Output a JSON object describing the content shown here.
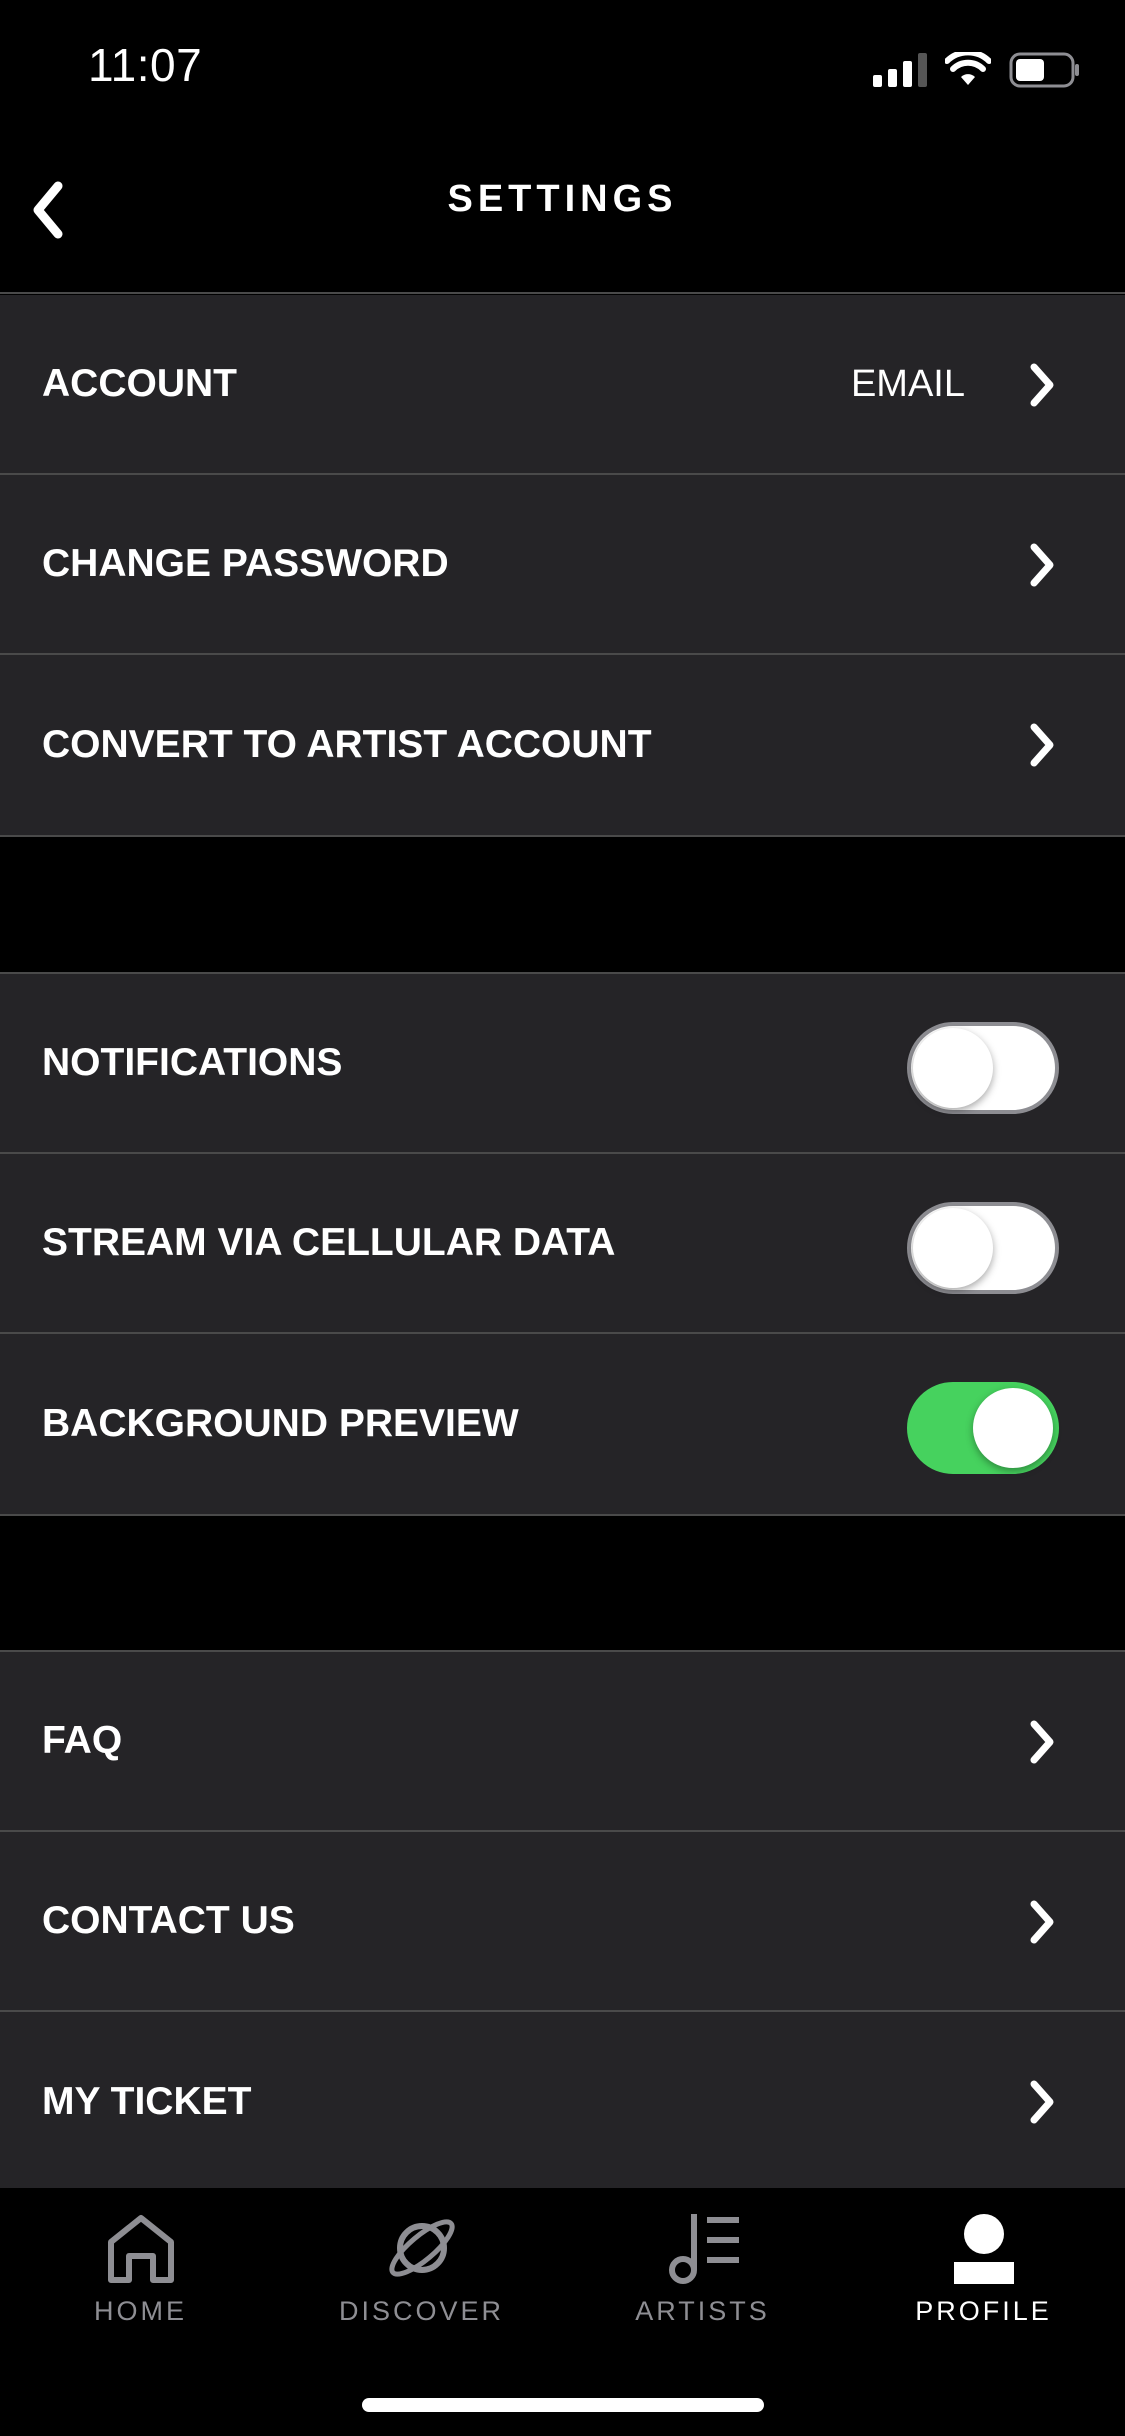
{
  "status_bar": {
    "time": "11:07"
  },
  "header": {
    "title": "SETTINGS"
  },
  "account_group": [
    {
      "label": "ACCOUNT",
      "value": "EMAIL"
    },
    {
      "label": "CHANGE PASSWORD"
    },
    {
      "label": "CONVERT TO ARTIST ACCOUNT"
    }
  ],
  "toggle_group": [
    {
      "label": "NOTIFICATIONS",
      "on": false
    },
    {
      "label": "STREAM VIA CELLULAR DATA",
      "on": false
    },
    {
      "label": "BACKGROUND PREVIEW",
      "on": true
    }
  ],
  "support_group": [
    {
      "label": "FAQ"
    },
    {
      "label": "CONTACT US"
    },
    {
      "label": "MY TICKET"
    }
  ],
  "tab_bar": {
    "tabs": [
      {
        "label": "HOME",
        "icon": "home-icon",
        "active": false
      },
      {
        "label": "DISCOVER",
        "icon": "planet-icon",
        "active": false
      },
      {
        "label": "ARTISTS",
        "icon": "music-note-list-icon",
        "active": false
      },
      {
        "label": "PROFILE",
        "icon": "person-icon",
        "active": true
      }
    ]
  },
  "colors": {
    "background": "#000000",
    "row_background": "#252427",
    "toggle_on": "#46d25e",
    "inactive_tab": "#8e8e93"
  }
}
